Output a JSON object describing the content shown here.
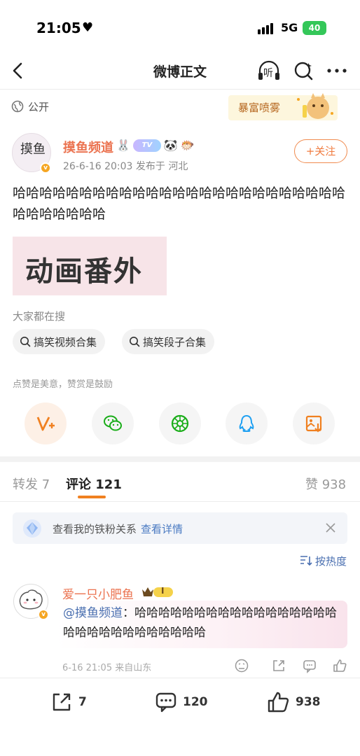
{
  "status_bar": {
    "time": "21:05",
    "network": "5G",
    "battery": "40"
  },
  "nav": {
    "title": "微博正文",
    "listen_label": "听"
  },
  "visibility": {
    "label": "公开"
  },
  "decor_text": "暴富喷雾",
  "author": {
    "name": "摸鱼频道",
    "avatar_text": "摸鱼",
    "tv_badge": "TV",
    "meta": "26-6-16 20:03  发布于 河北",
    "follow_label": "+关注"
  },
  "post": {
    "text": "哈哈哈哈哈哈哈哈哈哈哈哈哈哈哈哈哈哈哈哈哈哈哈哈哈哈哈哈哈哈哈哈",
    "image_text": "动画番外"
  },
  "search": {
    "heading": "大家都在搜",
    "chips": [
      "搞笑视频合集",
      "搞笑段子合集"
    ]
  },
  "reward": {
    "text": "点赞是美意，赞赏是鼓励"
  },
  "tabs": {
    "forward": "转发 7",
    "comments": "评论 121",
    "likes": "赞 938"
  },
  "fan_banner": {
    "text": "查看我的铁粉关系",
    "link": "查看详情"
  },
  "sort": {
    "label": "按热度"
  },
  "comment": {
    "user": "爱一只小肥鱼",
    "level_badge": "I",
    "mention": "@摸鱼频道",
    "separator": "：",
    "text": "哈哈哈哈哈哈哈哈哈哈哈哈哈哈哈哈哈哈哈哈哈哈哈哈哈哈哈哈哈",
    "meta": "6-16 21:05 来自山东"
  },
  "bottom_bar": {
    "reposts": "7",
    "comments": "120",
    "likes": "938"
  },
  "colors": {
    "accent": "#eb7350",
    "link": "#4a6fb0",
    "tab_indicator": "#f08020"
  }
}
